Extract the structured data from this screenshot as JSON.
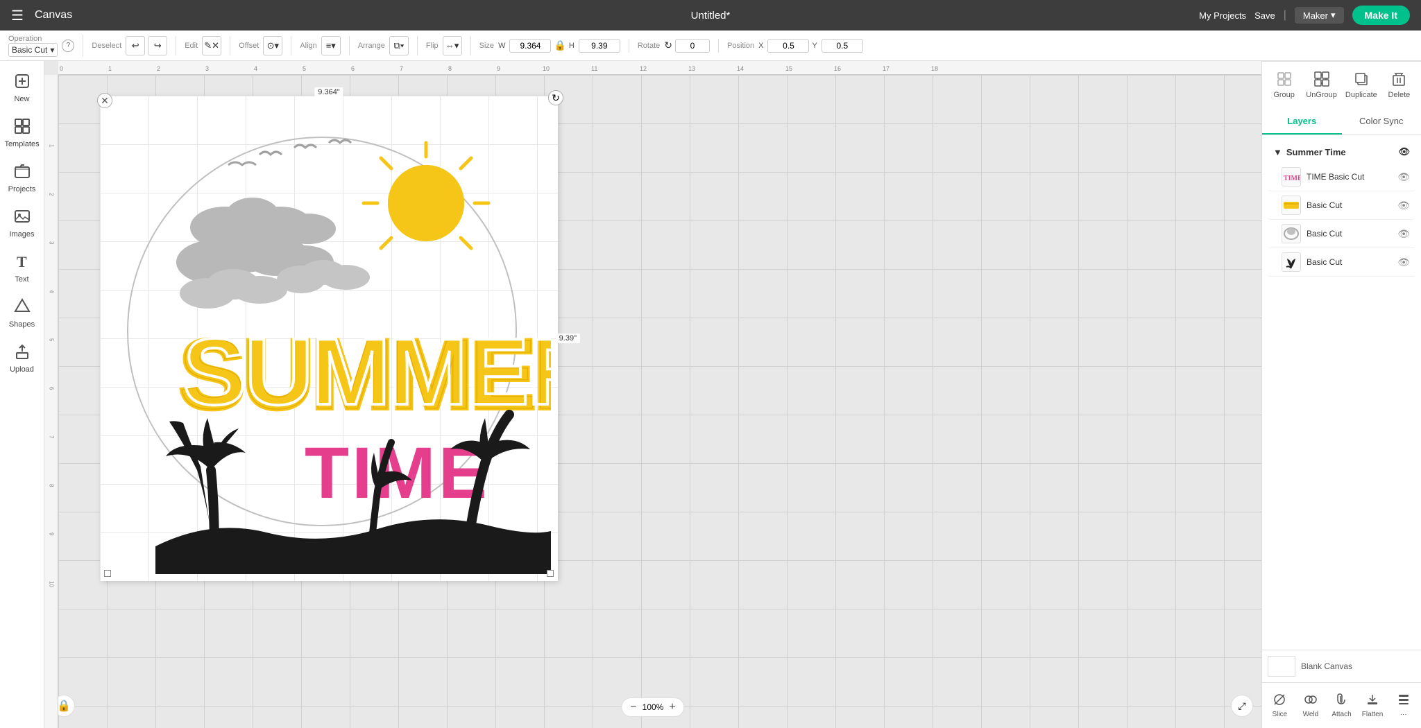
{
  "app": {
    "title": "Canvas",
    "doc_title": "Untitled*",
    "hamburger": "☰"
  },
  "nav": {
    "my_projects": "My Projects",
    "save": "Save",
    "divider": "|",
    "maker": "Maker",
    "maker_chevron": "▾",
    "make_it": "Make It"
  },
  "toolbar": {
    "operation_label": "Operation",
    "operation_value": "Basic Cut",
    "deselect_label": "Deselect",
    "edit_label": "Edit",
    "offset_label": "Offset",
    "align_label": "Align",
    "arrange_label": "Arrange",
    "flip_label": "Flip",
    "size_label": "Size",
    "w_label": "W",
    "w_value": "9.364",
    "lock_icon": "🔒",
    "h_label": "H",
    "h_value": "9.39",
    "rotate_label": "Rotate",
    "rotate_value": "0",
    "position_label": "Position",
    "x_label": "X",
    "x_value": "0.5",
    "y_label": "Y",
    "y_value": "0.5",
    "info_label": "?"
  },
  "sidebar": {
    "items": [
      {
        "id": "new",
        "label": "New",
        "icon": "+"
      },
      {
        "id": "templates",
        "label": "Templates",
        "icon": "⊞"
      },
      {
        "id": "projects",
        "label": "Projects",
        "icon": "📁"
      },
      {
        "id": "images",
        "label": "Images",
        "icon": "🖼"
      },
      {
        "id": "text",
        "label": "Text",
        "icon": "T"
      },
      {
        "id": "shapes",
        "label": "Shapes",
        "icon": "◇"
      },
      {
        "id": "upload",
        "label": "Upload",
        "icon": "⬆"
      }
    ]
  },
  "canvas": {
    "size_label_top": "9.364\"",
    "size_label_right": "9.39\"",
    "zoom_level": "100%"
  },
  "ruler": {
    "marks": [
      "0",
      "1",
      "2",
      "3",
      "4",
      "5",
      "6",
      "7",
      "8",
      "9",
      "10",
      "11",
      "12",
      "13",
      "14",
      "15",
      "16",
      "17",
      "18"
    ],
    "v_marks": [
      "1",
      "2",
      "3",
      "4",
      "5",
      "6",
      "7",
      "8",
      "9",
      "10"
    ]
  },
  "right_panel": {
    "tabs": [
      {
        "id": "layers",
        "label": "Layers"
      },
      {
        "id": "color_sync",
        "label": "Color Sync"
      }
    ],
    "active_tab": "layers",
    "group_name": "Summer Time",
    "layers": [
      {
        "id": "layer1",
        "label": "TIME Basic Cut",
        "thumb_color": "#e53e8c",
        "thumb_type": "text",
        "visible": true
      },
      {
        "id": "layer2",
        "label": "Basic Cut",
        "thumb_color": "#f5c518",
        "thumb_type": "image",
        "visible": true
      },
      {
        "id": "layer3",
        "label": "Basic Cut",
        "thumb_color": "#888",
        "thumb_type": "plain",
        "visible": true
      },
      {
        "id": "layer4",
        "label": "Basic Cut",
        "thumb_color": "#333",
        "thumb_type": "circle",
        "visible": true
      }
    ],
    "top_actions": [
      {
        "id": "group",
        "label": "Group",
        "icon": "⊞",
        "disabled": false
      },
      {
        "id": "ungroup",
        "label": "UnGroup",
        "icon": "⊟",
        "disabled": false
      },
      {
        "id": "duplicate",
        "label": "Duplicate",
        "icon": "⧉",
        "disabled": false
      },
      {
        "id": "delete",
        "label": "Delete",
        "icon": "🗑",
        "disabled": false
      }
    ],
    "blank_canvas_label": "Blank Canvas",
    "bottom_actions": [
      {
        "id": "slice",
        "label": "Slice",
        "icon": "✂"
      },
      {
        "id": "weld",
        "label": "Weld",
        "icon": "⊕"
      },
      {
        "id": "attach",
        "label": "Attach",
        "icon": "📎"
      },
      {
        "id": "flatten",
        "label": "Flatten",
        "icon": "⬇"
      },
      {
        "id": "extra",
        "label": "...",
        "icon": "⋯"
      }
    ]
  }
}
